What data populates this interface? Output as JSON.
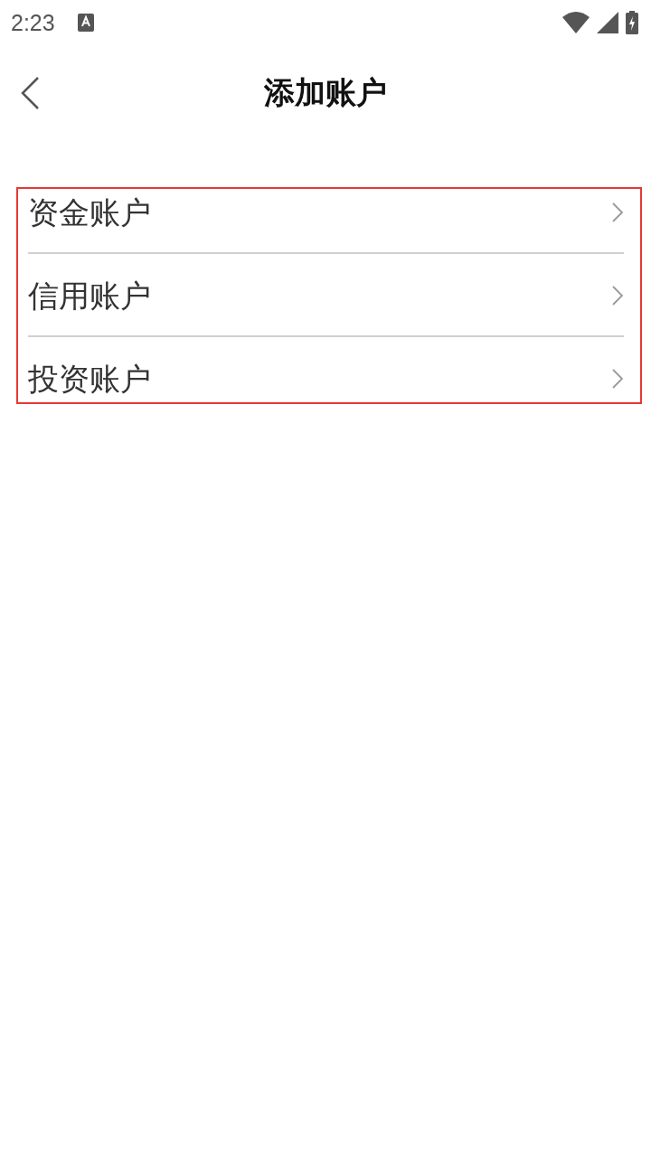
{
  "status_bar": {
    "time": "2:23"
  },
  "header": {
    "title": "添加账户"
  },
  "accounts": [
    {
      "label": "资金账户"
    },
    {
      "label": "信用账户"
    },
    {
      "label": "投资账户"
    }
  ]
}
